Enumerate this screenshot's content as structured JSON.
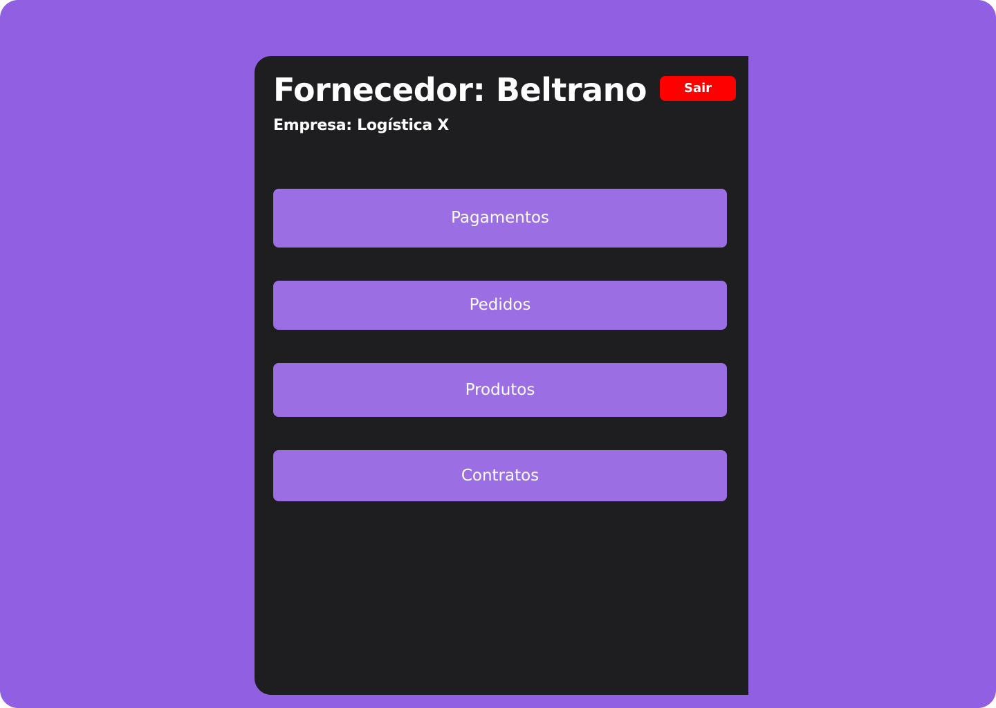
{
  "header": {
    "title": "Fornecedor:  Beltrano",
    "subtitle": "Empresa: Logística X",
    "logout_label": "Sair"
  },
  "menu": {
    "items": [
      {
        "label": "Pagamentos"
      },
      {
        "label": "Pedidos"
      },
      {
        "label": "Produtos"
      },
      {
        "label": "Contratos"
      }
    ]
  },
  "colors": {
    "background": "#915fe1",
    "panel": "#1e1e21",
    "menu_button": "#9b6ee3",
    "logout_button": "#ff0000",
    "text": "#ffffff"
  }
}
